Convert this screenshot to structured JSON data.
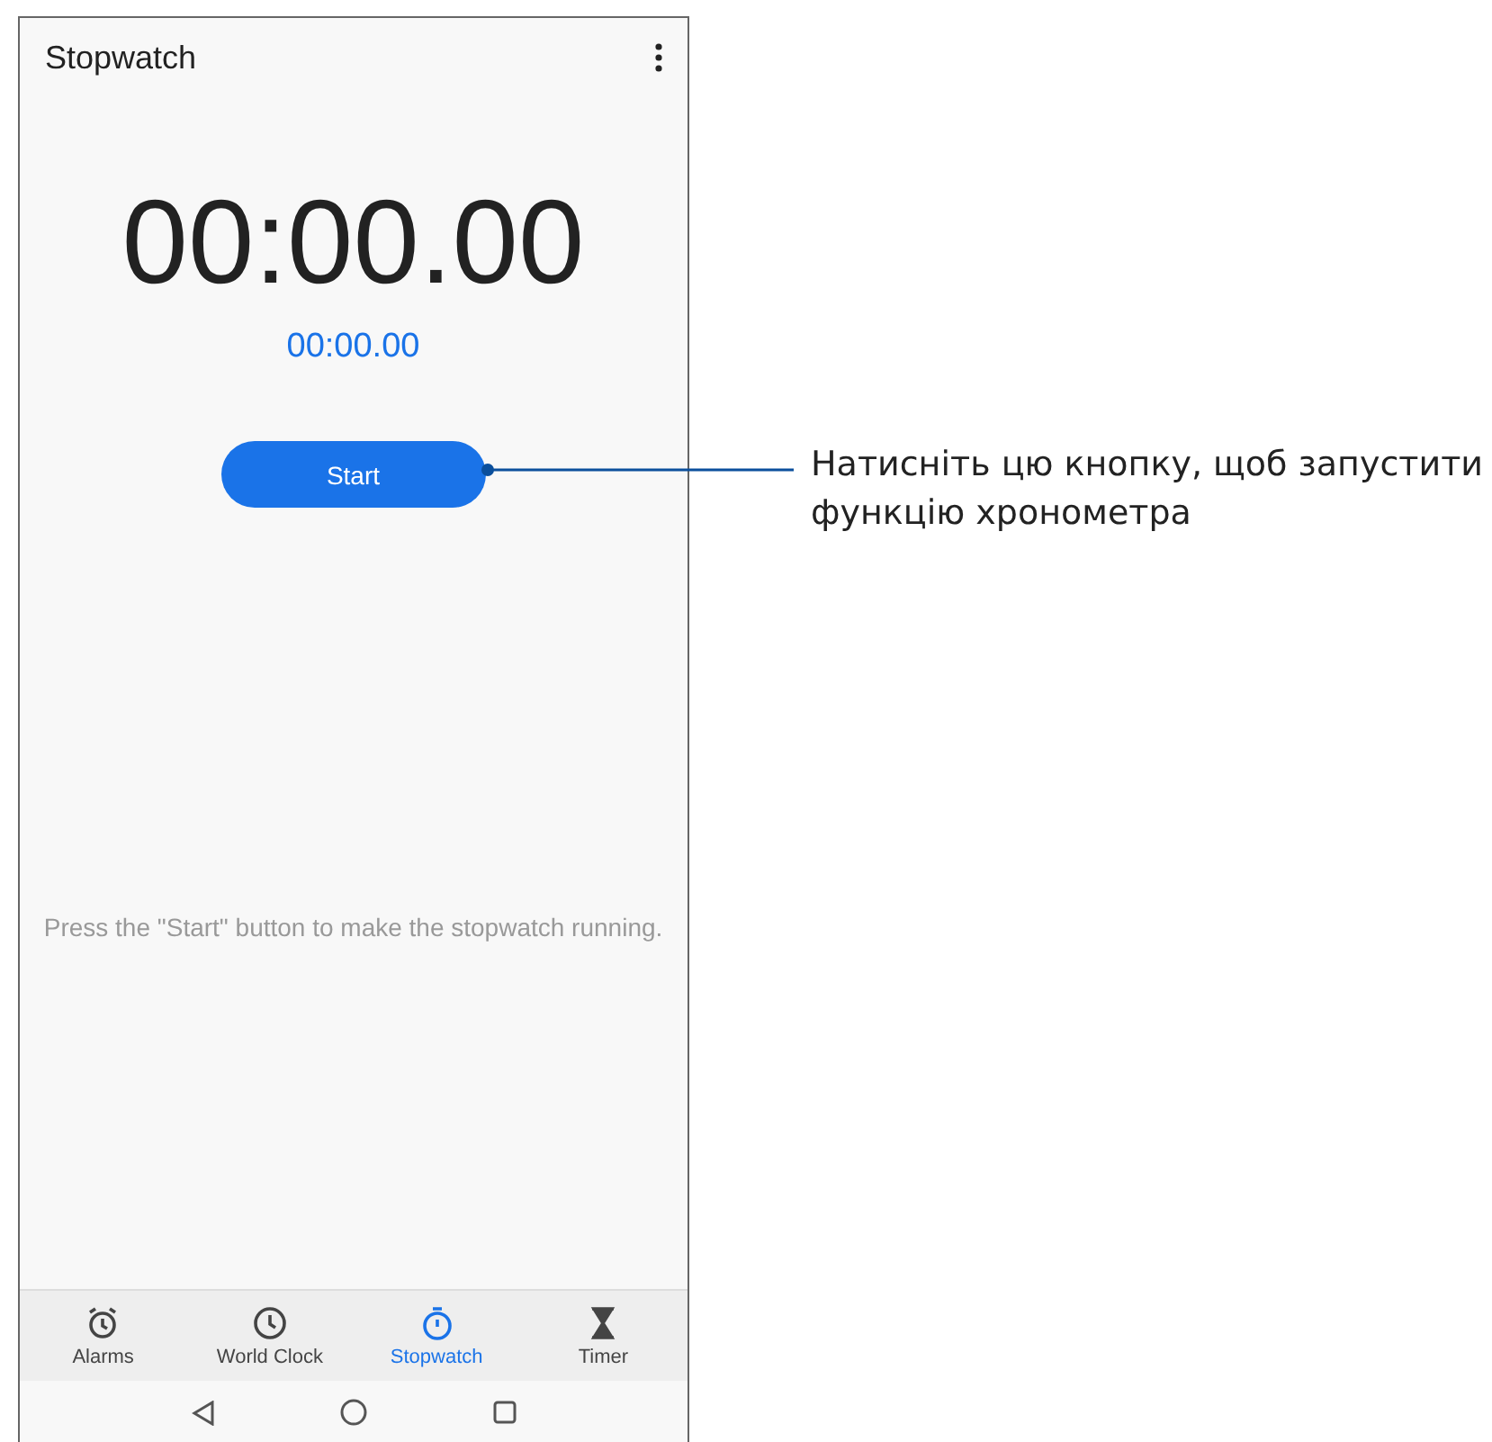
{
  "app_bar": {
    "title": "Stopwatch"
  },
  "stopwatch": {
    "time": "00:00.00",
    "lap_time": "00:00.00",
    "start_button": "Start",
    "hint": "Press the \"Start\" button to make the stopwatch running."
  },
  "tabs": [
    {
      "label": "Alarms",
      "kind": "alarm",
      "selected": false
    },
    {
      "label": "World Clock",
      "kind": "clock",
      "selected": false
    },
    {
      "label": "Stopwatch",
      "kind": "stopwatch",
      "selected": true
    },
    {
      "label": "Timer",
      "kind": "timer",
      "selected": false
    }
  ],
  "callout": {
    "text": "Натисніть цю кнопку, щоб запустити функцію хронометра"
  }
}
